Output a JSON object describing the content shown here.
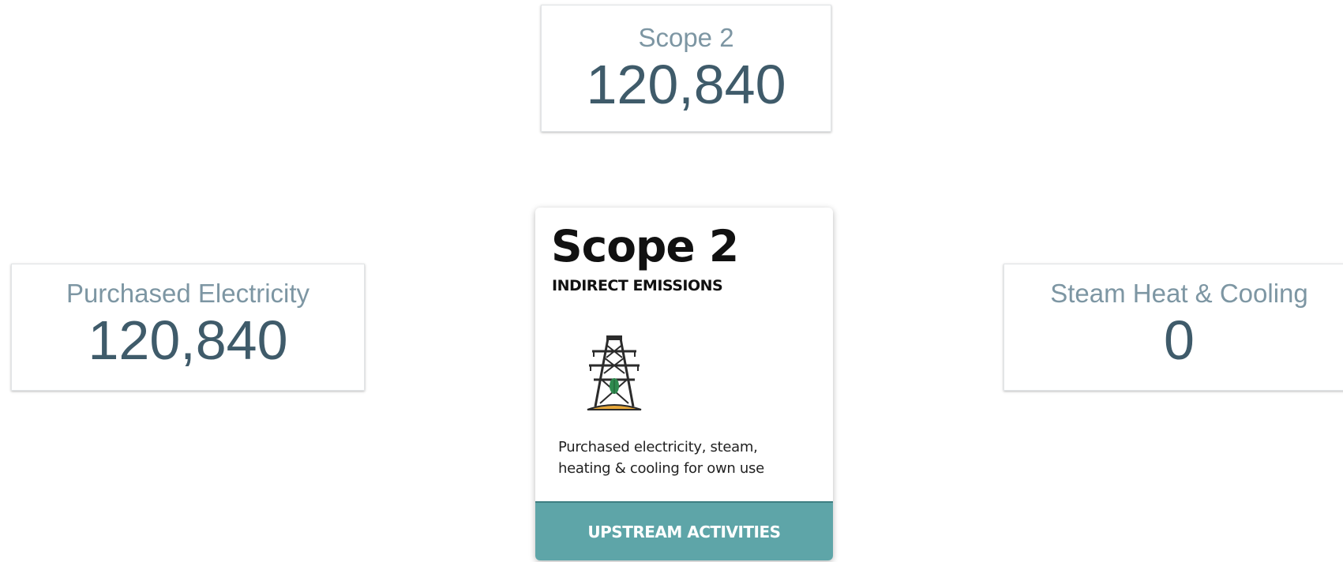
{
  "kpis": {
    "scope2": {
      "label": "Scope 2",
      "value": "120,840"
    },
    "purchased_electricity": {
      "label": "Purchased Electricity",
      "value": "120,840"
    },
    "steam_heat_cooling": {
      "label": "Steam Heat & Cooling",
      "value": "0"
    }
  },
  "scope_card": {
    "title": "Scope 2",
    "subtitle": "INDIRECT EMISSIONS",
    "icon": "power-tower-icon",
    "description": "Purchased electricity, steam, heating & cooling for own use",
    "footer": "UPSTREAM ACTIVITIES"
  },
  "colors": {
    "label": "#7d96a3",
    "value": "#3f5b6a",
    "footer_bg": "#5ea5a8",
    "icon_accent": "#e8a83a",
    "icon_leaf": "#2f8a4f"
  }
}
